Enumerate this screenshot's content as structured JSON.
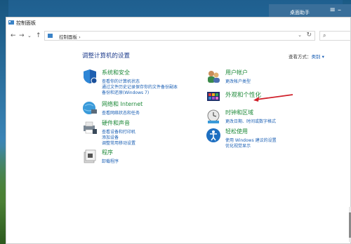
{
  "desktop_window": {
    "title": "桌面助手",
    "menu_glyph": "≡ –"
  },
  "window": {
    "title": "控制面板"
  },
  "nav": {
    "back": "←",
    "forward": "→",
    "recent": "⌄",
    "up": "↑",
    "address": "控制面板  ›",
    "dropdown": "⌄",
    "refresh": "↻",
    "search": "⌕"
  },
  "main": {
    "heading": "调整计算机的设置",
    "view_by_label": "查看方式：",
    "view_by_value": "类别 ▾"
  },
  "categories": [
    {
      "title": "系统和安全",
      "links": [
        "查看你的计算机状态",
        "通过文件历史记录保存你的文件备份副本",
        "备份和还原(Windows 7)"
      ]
    },
    {
      "title": "网络和 Internet",
      "links": [
        "查看网络状态和任务"
      ]
    },
    {
      "title": "硬件和声音",
      "links": [
        "查看设备和打印机",
        "添加设备",
        "调整常用移动设置"
      ]
    },
    {
      "title": "程序",
      "links": [
        "卸载程序"
      ]
    },
    {
      "title": "用户帐户",
      "links": [
        "更改帐户类型"
      ]
    },
    {
      "title": "外观和个性化",
      "links": []
    },
    {
      "title": "时钟和区域",
      "links": [
        "更改日期、时间或数字格式"
      ]
    },
    {
      "title": "轻松使用",
      "links": [
        "使用 Windows 建议的设置",
        "优化视觉显示"
      ]
    }
  ],
  "colors": {
    "category_title": "#1f8a3a",
    "link": "#1a5fb4",
    "heading": "#1e3c8c",
    "annotation_arrow": "#d0202a"
  }
}
